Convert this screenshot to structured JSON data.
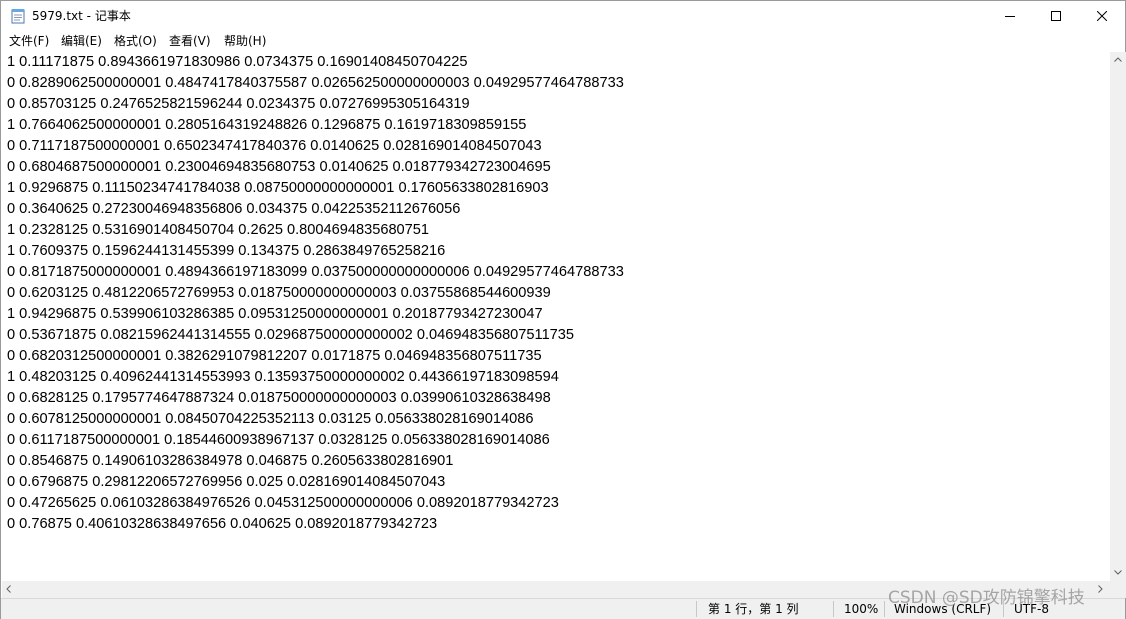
{
  "window": {
    "title": "5979.txt - 记事本",
    "icon": "notepad-icon"
  },
  "menu": [
    {
      "label": "文件(F)"
    },
    {
      "label": "编辑(E)"
    },
    {
      "label": "格式(O)"
    },
    {
      "label": "查看(V)"
    },
    {
      "label": "帮助(H)"
    }
  ],
  "editor": {
    "lines": [
      "1 0.11171875 0.8943661971830986 0.0734375 0.16901408450704225",
      "0 0.8289062500000001 0.4847417840375587 0.026562500000000003 0.04929577464788733",
      "0 0.85703125 0.2476525821596244 0.0234375 0.07276995305164319",
      "1 0.7664062500000001 0.2805164319248826 0.1296875 0.1619718309859155",
      "0 0.7117187500000001 0.6502347417840376 0.0140625 0.028169014084507043",
      "0 0.6804687500000001 0.23004694835680753 0.0140625 0.018779342723004695",
      "1 0.9296875 0.11150234741784038 0.08750000000000001 0.17605633802816903",
      "0 0.3640625 0.27230046948356806 0.034375 0.04225352112676056",
      "1 0.2328125 0.5316901408450704 0.2625 0.8004694835680751",
      "1 0.7609375 0.1596244131455399 0.134375 0.2863849765258216",
      "0 0.8171875000000001 0.4894366197183099 0.037500000000000006 0.04929577464788733",
      "0 0.6203125 0.4812206572769953 0.018750000000000003 0.03755868544600939",
      "1 0.94296875 0.539906103286385 0.09531250000000001 0.20187793427230047",
      "0 0.53671875 0.08215962441314555 0.029687500000000002 0.046948356807511735",
      "0 0.6820312500000001 0.3826291079812207 0.0171875 0.046948356807511735",
      "1 0.48203125 0.40962441314553993 0.13593750000000002 0.44366197183098594",
      "0 0.6828125 0.1795774647887324 0.018750000000000003 0.03990610328638498",
      "0 0.6078125000000001 0.08450704225352113 0.03125 0.056338028169014086",
      "0 0.6117187500000001 0.18544600938967137 0.0328125 0.056338028169014086",
      "0 0.8546875 0.14906103286384978 0.046875 0.2605633802816901",
      "0 0.6796875 0.29812206572769956 0.025 0.028169014084507043",
      "0 0.47265625 0.06103286384976526 0.045312500000000006 0.0892018779342723",
      "0 0.76875 0.40610328638497656 0.040625 0.0892018779342723"
    ]
  },
  "status": {
    "position": "第 1 行，第 1 列",
    "zoom": "100%",
    "line_ending": "Windows (CRLF)",
    "encoding": "UTF-8"
  },
  "watermark": "CSDN @SD攻防锦擎科技"
}
